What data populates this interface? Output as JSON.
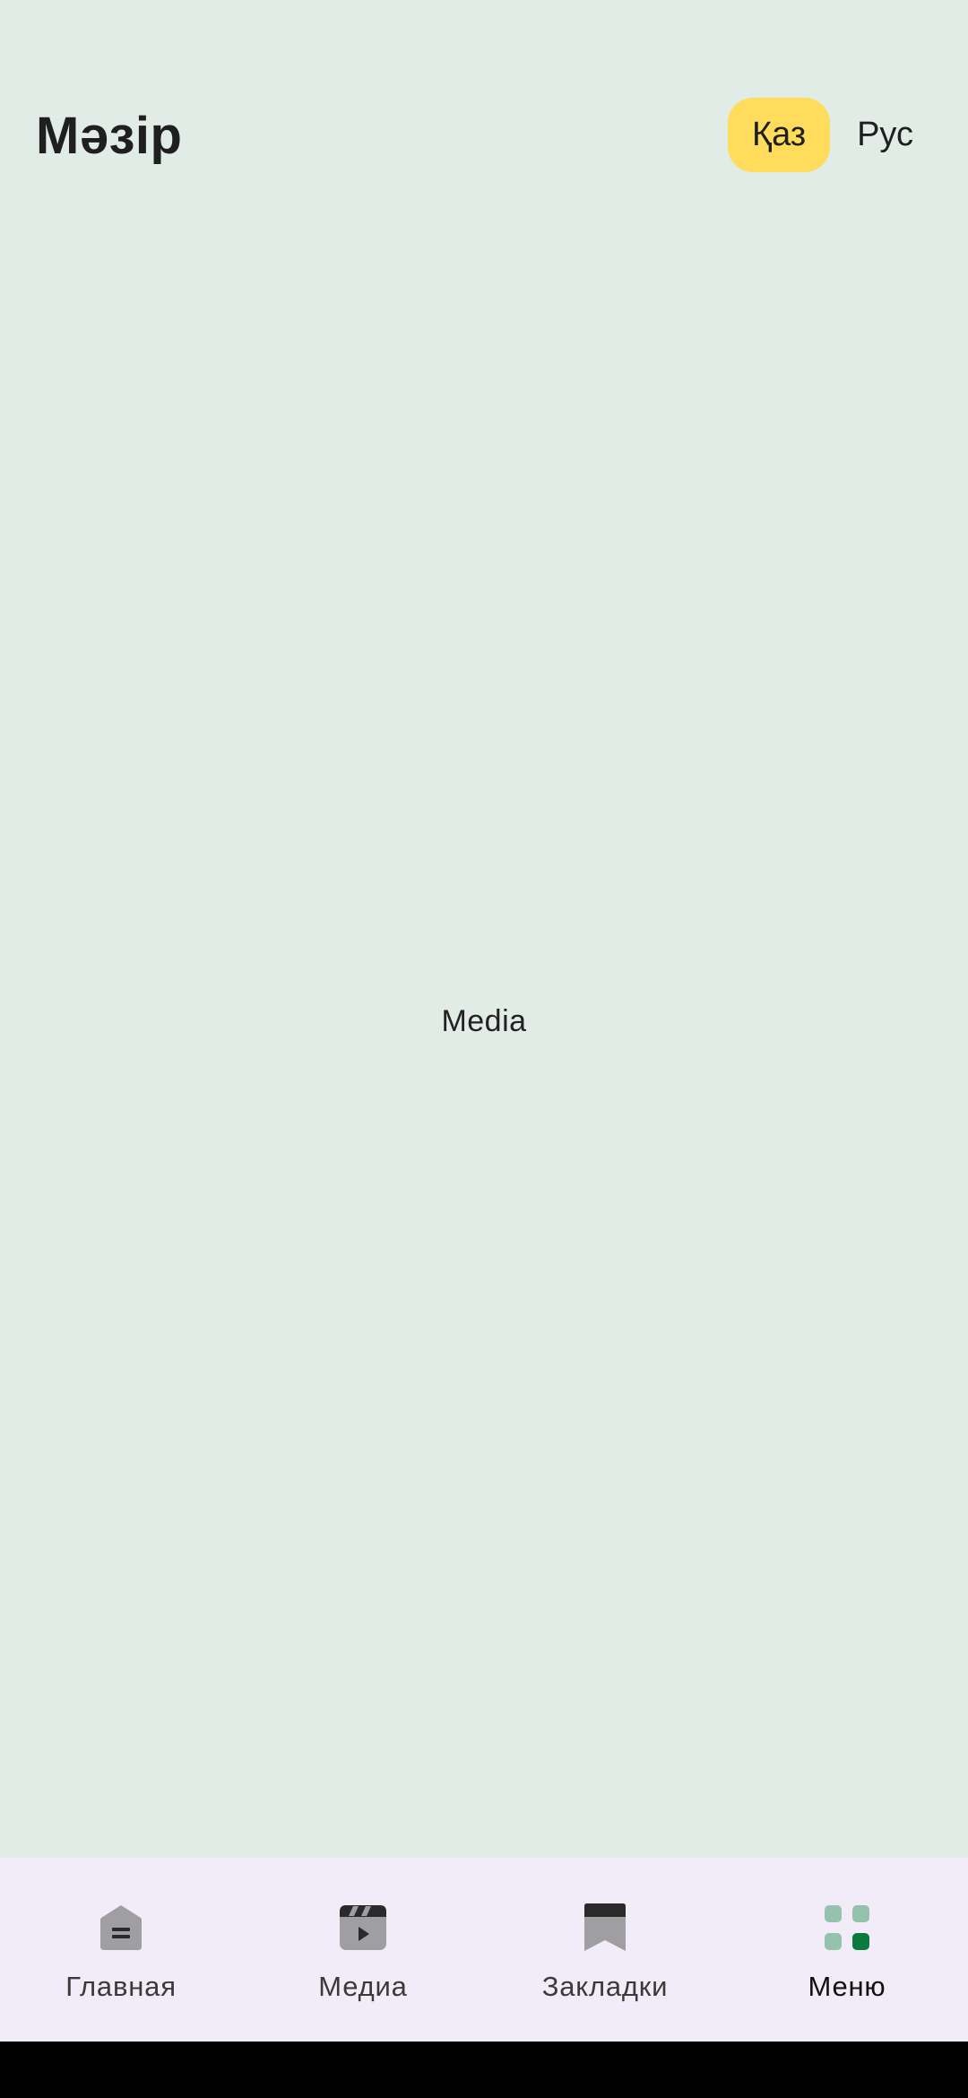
{
  "header": {
    "title": "Мәзір",
    "languages": [
      {
        "label": "Қаз",
        "active": true
      },
      {
        "label": "Рус",
        "active": false
      }
    ]
  },
  "main": {
    "placeholder_text": "Media"
  },
  "bottom_nav": {
    "items": [
      {
        "label": "Главная",
        "icon": "home-icon",
        "active": false
      },
      {
        "label": "Медиа",
        "icon": "media-clapper-icon",
        "active": false
      },
      {
        "label": "Закладки",
        "icon": "bookmark-icon",
        "active": false
      },
      {
        "label": "Меню",
        "icon": "menu-grid-icon",
        "active": true
      }
    ]
  },
  "colors": {
    "background": "#e2ece6",
    "nav_background": "#f2ecf8",
    "lang_active": "#ffdc5b",
    "accent_green": "#0a7a3e",
    "accent_green_light": "#95c2ad",
    "icon_gray": "#9e9ea3"
  }
}
